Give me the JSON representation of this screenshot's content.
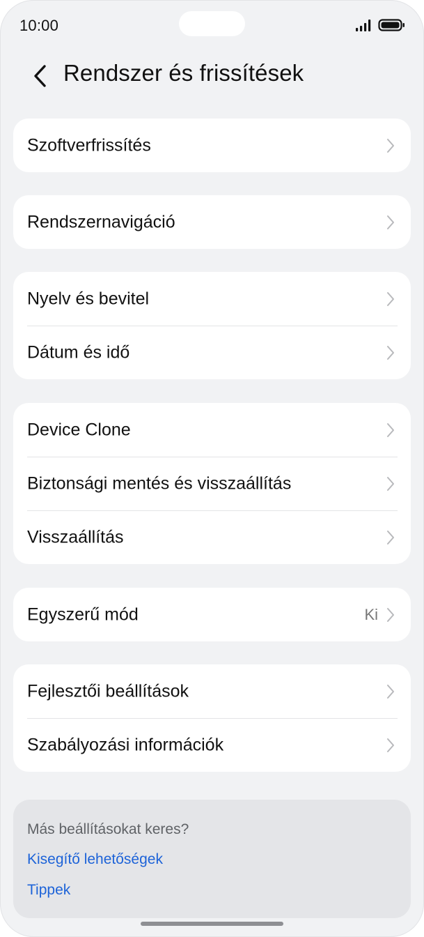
{
  "status_bar": {
    "time": "10:00"
  },
  "header": {
    "title": "Rendszer és frissítések"
  },
  "groups": [
    {
      "items": [
        {
          "label": "Szoftverfrissítés"
        }
      ]
    },
    {
      "items": [
        {
          "label": "Rendszernavigáció"
        }
      ]
    },
    {
      "items": [
        {
          "label": "Nyelv és bevitel"
        },
        {
          "label": "Dátum és idő"
        }
      ]
    },
    {
      "items": [
        {
          "label": "Device Clone"
        },
        {
          "label": "Biztonsági mentés és visszaállítás"
        },
        {
          "label": "Visszaállítás"
        }
      ]
    },
    {
      "items": [
        {
          "label": "Egyszerű mód",
          "value": "Ki"
        }
      ]
    },
    {
      "items": [
        {
          "label": "Fejlesztői beállítások"
        },
        {
          "label": "Szabályozási információk"
        }
      ]
    }
  ],
  "suggestions": {
    "title": "Más beállításokat keres?",
    "links": [
      "Kisegítő lehetőségek",
      "Tippek"
    ]
  },
  "colors": {
    "background": "#f1f2f4",
    "card": "#ffffff",
    "link": "#1d63d8",
    "chevron": "#b8b9bc"
  }
}
